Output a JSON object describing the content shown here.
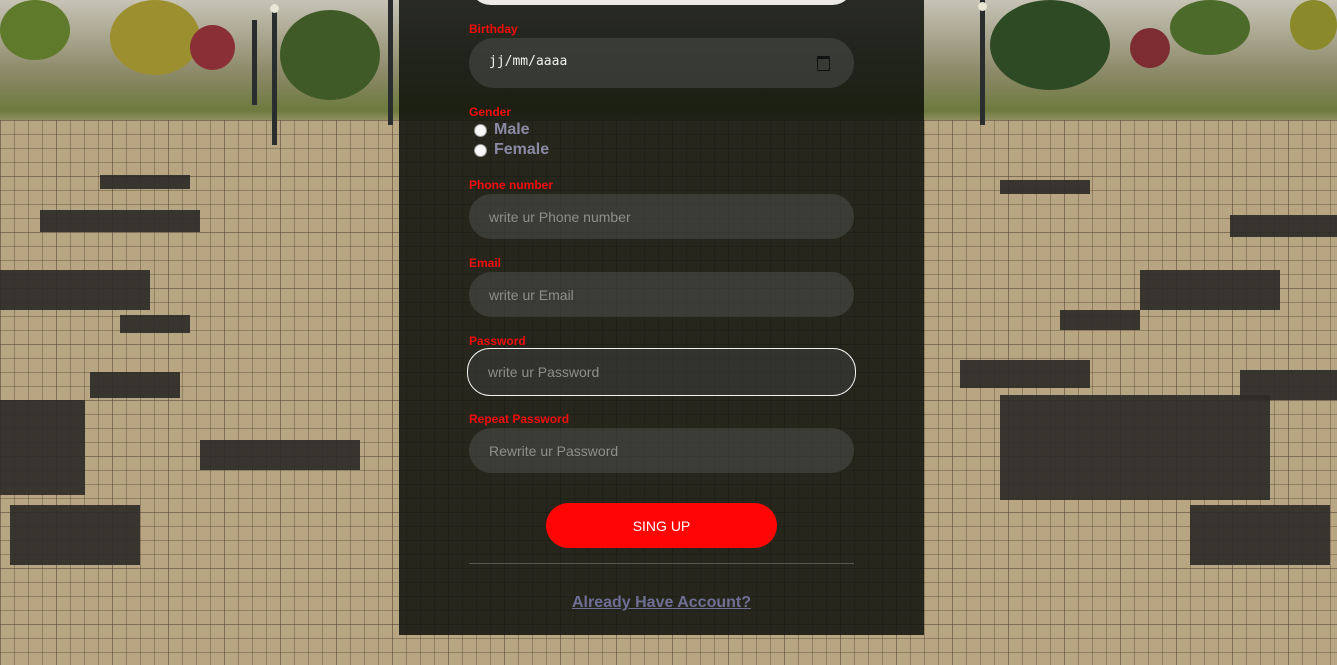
{
  "form": {
    "birthday": {
      "label": "Birthday",
      "value": "jj/mm/aaaa"
    },
    "gender": {
      "label": "Gender",
      "options": [
        "Male",
        "Female"
      ]
    },
    "phone": {
      "label": "Phone number",
      "placeholder": "write ur Phone number"
    },
    "email": {
      "label": "Email",
      "placeholder": "write ur Email"
    },
    "password": {
      "label": "Password",
      "placeholder": "write ur Password"
    },
    "repeat_password": {
      "label": "Repeat Password",
      "placeholder": "Rewrite ur Password"
    },
    "submit_label": "SING UP",
    "login_link": "Already Have Account?"
  },
  "colors": {
    "accent": "#ff0505",
    "label": "#f20d0d",
    "link": "#6f6f96"
  },
  "icons": {
    "date_picker": "calendar-icon"
  }
}
